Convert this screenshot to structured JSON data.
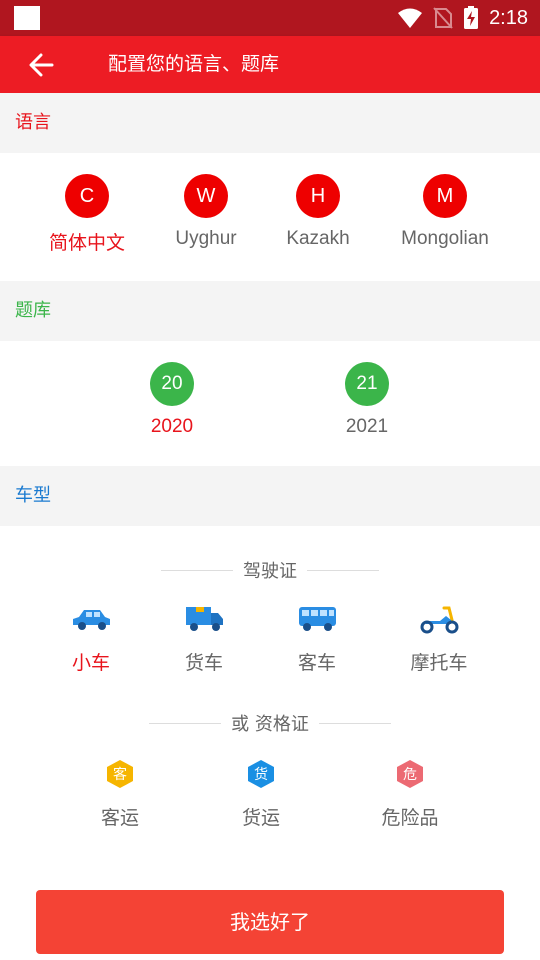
{
  "status_bar": {
    "time": "2:18"
  },
  "app_bar": {
    "title": "配置您的语言、题库"
  },
  "language_section": {
    "header": "语言",
    "header_color": "#e8141c",
    "items": [
      {
        "letter": "C",
        "label": "简体中文",
        "selected": true
      },
      {
        "letter": "W",
        "label": "Uyghur",
        "selected": false
      },
      {
        "letter": "H",
        "label": "Kazakh",
        "selected": false
      },
      {
        "letter": "M",
        "label": "Mongolian",
        "selected": false
      }
    ]
  },
  "bank_section": {
    "header": "题库",
    "header_color": "#3bb54a",
    "items": [
      {
        "badge": "20",
        "label": "2020",
        "selected": true
      },
      {
        "badge": "21",
        "label": "2021",
        "selected": false
      }
    ]
  },
  "vehicle_section": {
    "header": "车型",
    "header_color": "#1a7ad0",
    "license_divider": "驾驶证",
    "vehicles": [
      {
        "icon": "car-icon",
        "label": "小车",
        "selected": true
      },
      {
        "icon": "truck-icon",
        "label": "货车",
        "selected": false
      },
      {
        "icon": "bus-icon",
        "label": "客车",
        "selected": false
      },
      {
        "icon": "motorcycle-icon",
        "label": "摩托车",
        "selected": false
      }
    ],
    "qualification_divider": "或 资格证",
    "qualifications": [
      {
        "badge": "客",
        "label": "客运",
        "color": "#f6b500"
      },
      {
        "badge": "货",
        "label": "货运",
        "color": "#1a8fe3"
      },
      {
        "badge": "危",
        "label": "危险品",
        "color": "#ec6a73"
      }
    ]
  },
  "confirm_button": {
    "label": "我选好了"
  },
  "colors": {
    "primary": "#ed1c24",
    "status_bar": "#b0161f",
    "button": "#f44335"
  }
}
